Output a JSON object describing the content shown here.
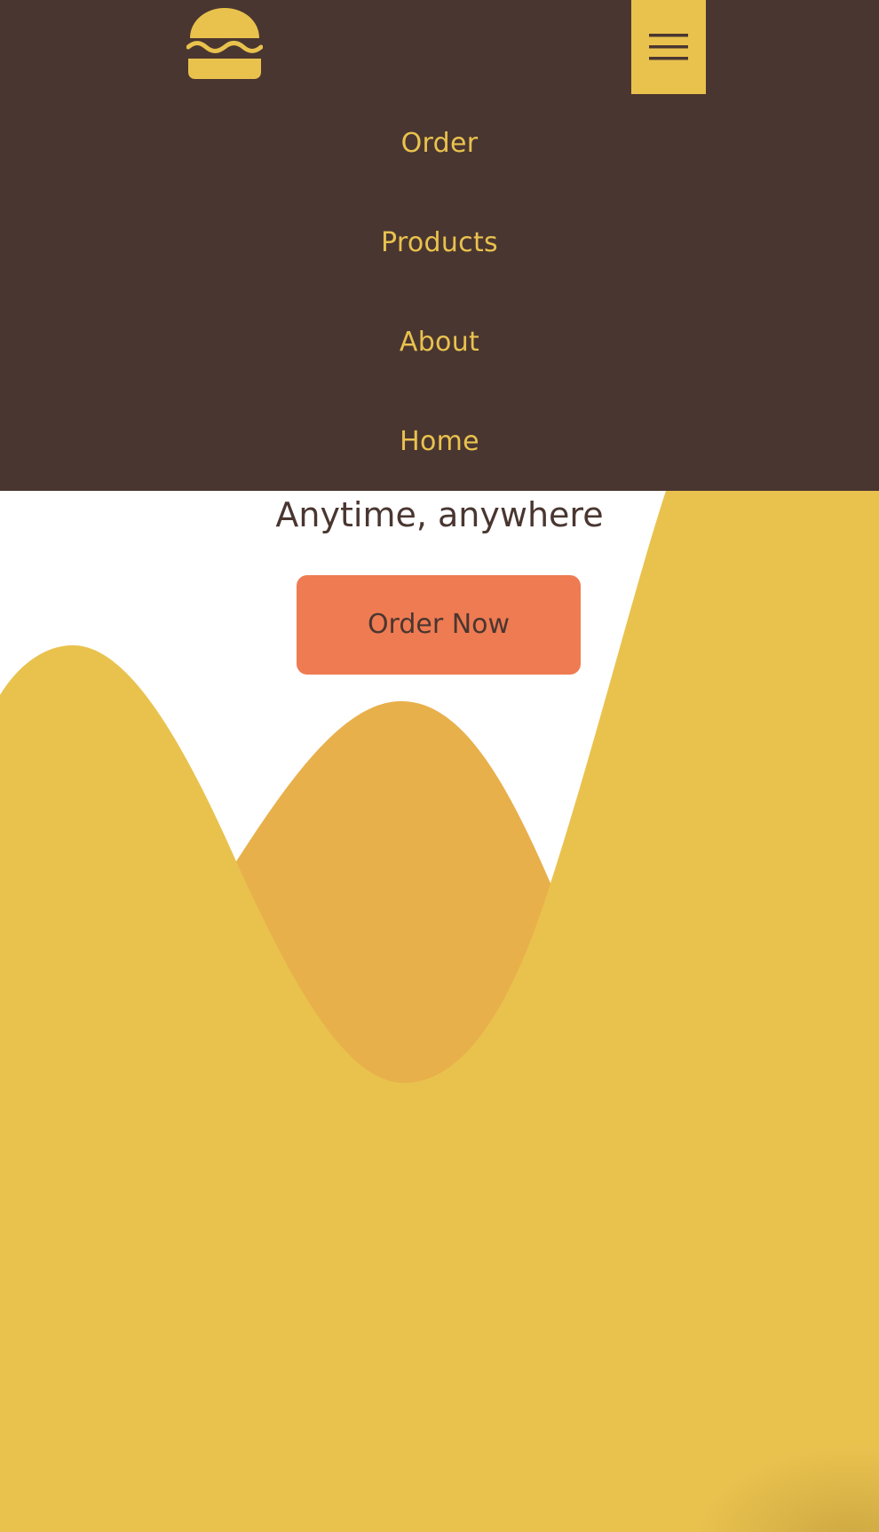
{
  "header": {
    "logo_icon": "burger-icon",
    "menu_icon": "hamburger-menu-icon"
  },
  "nav": {
    "items": [
      {
        "label": "Order"
      },
      {
        "label": "Products"
      },
      {
        "label": "About"
      },
      {
        "label": "Home"
      }
    ]
  },
  "hero": {
    "tagline": "Anytime, anywhere",
    "cta_label": "Order Now"
  },
  "colors": {
    "header_bg": "#4a3630",
    "accent_yellow": "#e9c24e",
    "wave_orange": "#e8b04b",
    "cta_bg": "#ef7b52",
    "text_dark": "#4a3630"
  }
}
